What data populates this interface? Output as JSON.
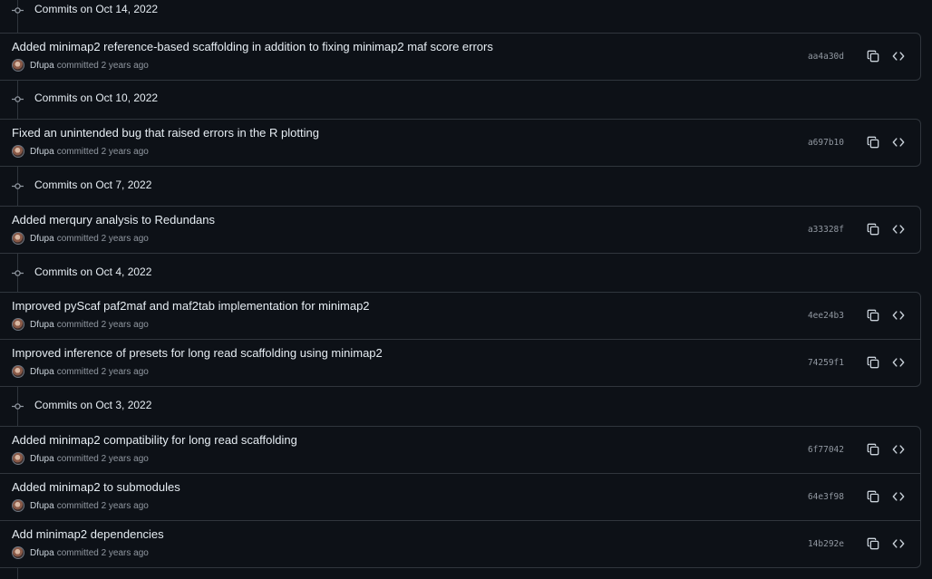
{
  "groups": [
    {
      "title": "Commits on Oct 14, 2022",
      "commits": [
        {
          "message": "Added minimap2 reference-based scaffolding in addition to fixing minimap2 maf score errors",
          "author": "Dfupa",
          "meta": "committed 2 years ago",
          "sha": "aa4a30d"
        }
      ]
    },
    {
      "title": "Commits on Oct 10, 2022",
      "commits": [
        {
          "message": "Fixed an unintended bug that raised errors in the R plotting",
          "author": "Dfupa",
          "meta": "committed 2 years ago",
          "sha": "a697b10"
        }
      ]
    },
    {
      "title": "Commits on Oct 7, 2022",
      "commits": [
        {
          "message": "Added merqury analysis to Redundans",
          "author": "Dfupa",
          "meta": "committed 2 years ago",
          "sha": "a33328f"
        }
      ]
    },
    {
      "title": "Commits on Oct 4, 2022",
      "commits": [
        {
          "message": "Improved pyScaf paf2maf and maf2tab implementation for minimap2",
          "author": "Dfupa",
          "meta": "committed 2 years ago",
          "sha": "4ee24b3"
        },
        {
          "message": "Improved inference of presets for long read scaffolding using minimap2",
          "author": "Dfupa",
          "meta": "committed 2 years ago",
          "sha": "74259f1"
        }
      ]
    },
    {
      "title": "Commits on Oct 3, 2022",
      "commits": [
        {
          "message": "Added minimap2 compatibility for long read scaffolding",
          "author": "Dfupa",
          "meta": "committed 2 years ago",
          "sha": "6f77042"
        },
        {
          "message": "Added minimap2 to submodules",
          "author": "Dfupa",
          "meta": "committed 2 years ago",
          "sha": "64e3f98"
        },
        {
          "message": "Add minimap2 dependencies",
          "author": "Dfupa",
          "meta": "committed 2 years ago",
          "sha": "14b292e"
        }
      ]
    }
  ],
  "icons": {
    "node": "git-commit-icon",
    "copy": "copy-icon",
    "browse": "code-icon"
  },
  "colors": {
    "background": "#0d1117",
    "border": "#30363d",
    "text": "#e6edf3",
    "muted": "#9198a1"
  }
}
